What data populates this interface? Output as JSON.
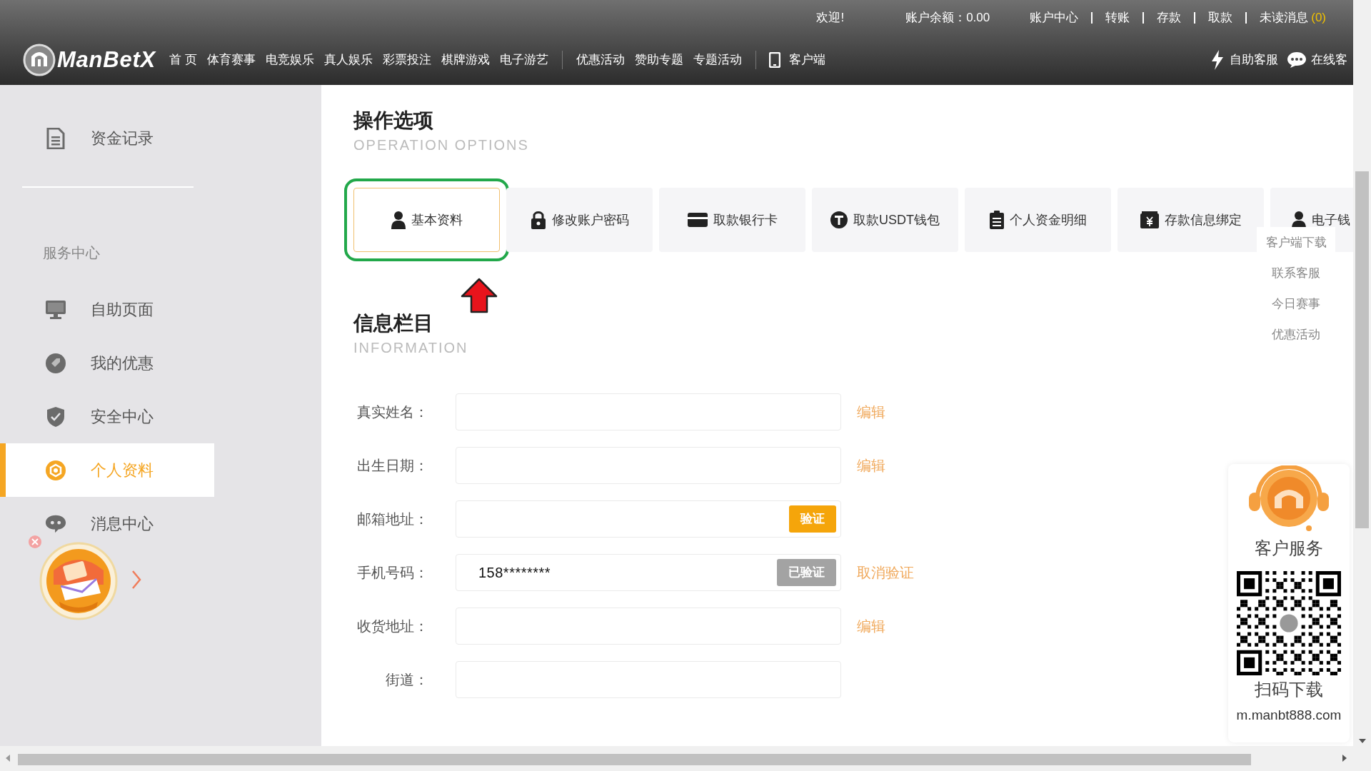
{
  "header": {
    "logo": "ManBetX",
    "welcome": "欢迎!",
    "balance": "账户余额：0.00",
    "account_links": [
      "账户中心",
      "转账",
      "存款",
      "取款"
    ],
    "unread_label": "未读消息",
    "unread_count": "(0)",
    "nav_groups": [
      [
        "首 页",
        "体育赛事",
        "电竞娱乐",
        "真人娱乐",
        "彩票投注",
        "棋牌游戏",
        "电子游艺"
      ],
      [
        "优惠活动",
        "赞助专题",
        "专题活动"
      ]
    ],
    "app_link": "客户端",
    "help_links": [
      "自助客服",
      "在线客"
    ]
  },
  "sidebar": {
    "items": [
      {
        "label": "资金记录",
        "selected": false
      }
    ],
    "section_title": "服务中心",
    "service_items": [
      {
        "label": "自助页面",
        "selected": false
      },
      {
        "label": "我的优惠",
        "selected": false
      },
      {
        "label": "安全中心",
        "selected": false
      },
      {
        "label": "个人资料",
        "selected": true
      },
      {
        "label": "消息中心",
        "selected": false
      }
    ]
  },
  "operations": {
    "title": "操作选项",
    "subtitle": "OPERATION OPTIONS",
    "tabs": [
      {
        "label": "基本资料",
        "selected": true
      },
      {
        "label": "修改账户密码",
        "selected": false
      },
      {
        "label": "取款银行卡",
        "selected": false
      },
      {
        "label": "取款USDT钱包",
        "selected": false
      },
      {
        "label": "个人资金明细",
        "selected": false
      },
      {
        "label": "存款信息绑定",
        "selected": false
      },
      {
        "label": "电子钱",
        "selected": false
      }
    ]
  },
  "floating_menu": [
    "客户端下载",
    "联系客服",
    "今日赛事",
    "优惠活动"
  ],
  "information": {
    "title": "信息栏目",
    "subtitle": "INFORMATION",
    "fields": [
      {
        "label": "真实姓名：",
        "action": "编辑"
      },
      {
        "label": "出生日期：",
        "action": "编辑"
      },
      {
        "label": "邮箱地址：",
        "button": {
          "label": "验证",
          "kind": "verify"
        }
      },
      {
        "label": "手机号码：",
        "value": "158********",
        "button": {
          "label": "已验证",
          "kind": "verified"
        },
        "action": "取消验证"
      },
      {
        "label": "收货地址：",
        "action": "编辑"
      },
      {
        "label": "街道："
      }
    ]
  },
  "support_panel": {
    "title": "客户服务",
    "qr_caption": "扫码下载",
    "url": "m.manbt888.com"
  }
}
